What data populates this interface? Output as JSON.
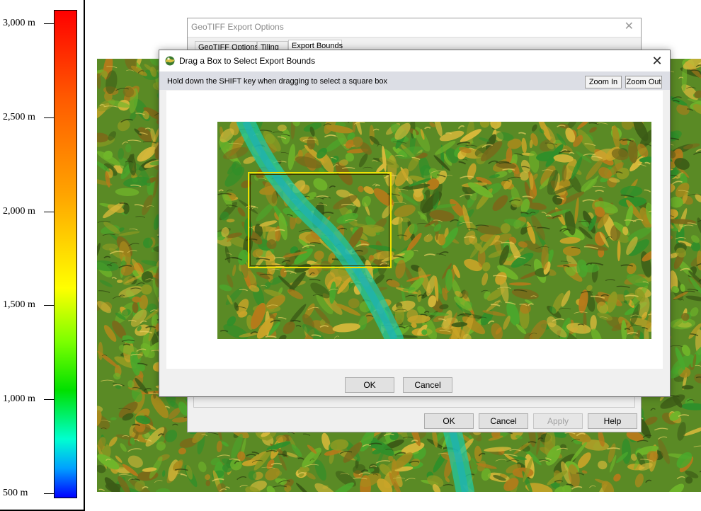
{
  "legend": {
    "ticks": [
      {
        "label": "3,000 m",
        "value": 3000
      },
      {
        "label": "2,500 m",
        "value": 2500
      },
      {
        "label": "2,000 m",
        "value": 2000
      },
      {
        "label": "1,500 m",
        "value": 1500
      },
      {
        "label": "1,000 m",
        "value": 1000
      },
      {
        "label": "500 m",
        "value": 500
      }
    ],
    "colors": [
      "#ff0000",
      "#ffa500",
      "#ffff00",
      "#00e000",
      "#00ffd0",
      "#0000ff"
    ]
  },
  "back_dialog": {
    "title": "GeoTIFF Export Options",
    "tabs": [
      "GeoTIFF Options",
      "Tiling",
      "Export Bounds"
    ],
    "active_tab": "Export Bounds",
    "buttons": {
      "ok": "OK",
      "cancel": "Cancel",
      "apply": "Apply",
      "help": "Help"
    }
  },
  "front_dialog": {
    "title": "Drag a Box to Select Export Bounds",
    "hint": "Hold down the SHIFT key when dragging to select a square box",
    "zoom_in": "Zoom In",
    "zoom_out": "Zoom Out",
    "buttons": {
      "ok": "OK",
      "cancel": "Cancel"
    }
  }
}
